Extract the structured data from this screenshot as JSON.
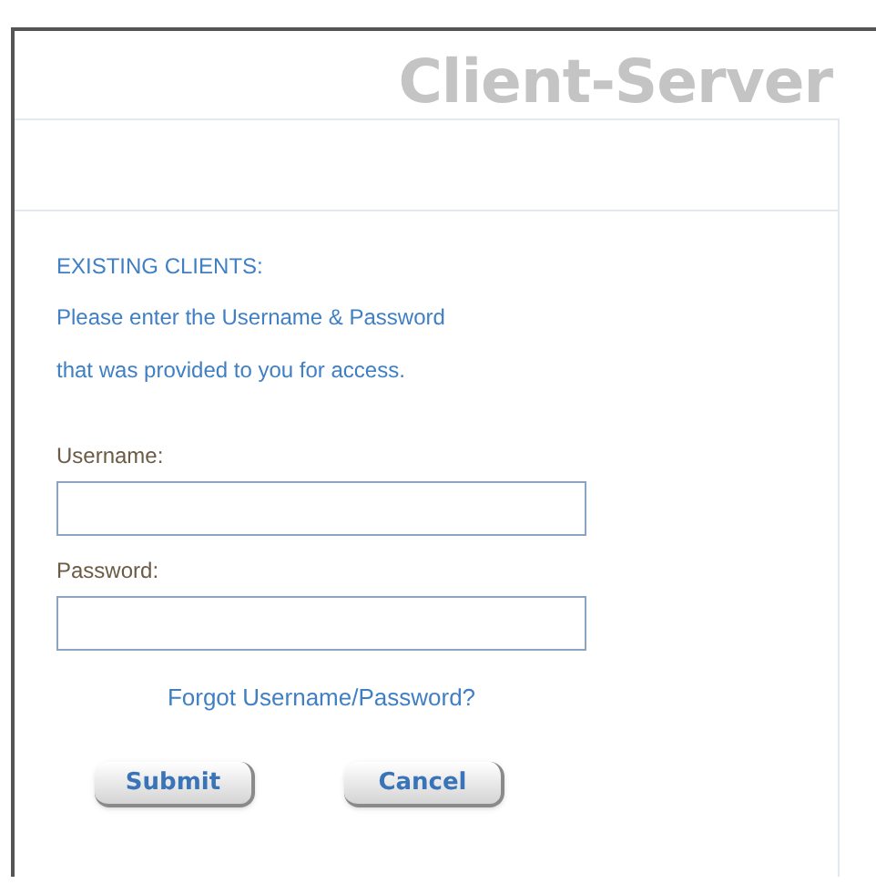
{
  "header": {
    "title": "Client-Server"
  },
  "login": {
    "heading": "EXISTING CLIENTS:",
    "instructions": [
      "Please enter the Username & Password",
      "that was provided to you for access."
    ],
    "fields": [
      {
        "label": "Username:"
      },
      {
        "label": "Password:"
      }
    ],
    "forgot_link": "Forgot Username/Password?",
    "buttons": [
      "Submit",
      "Cancel"
    ]
  }
}
